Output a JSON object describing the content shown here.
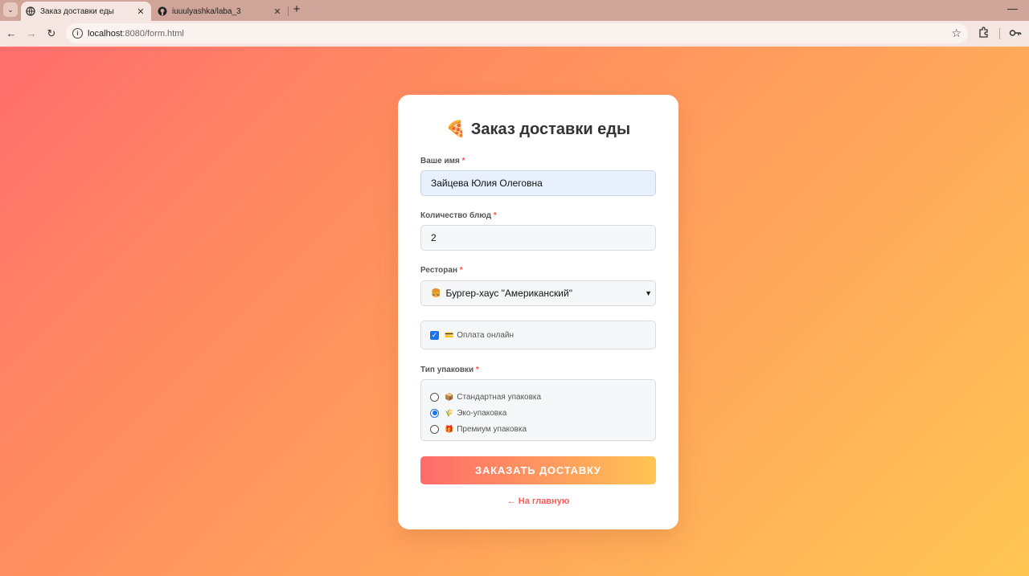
{
  "browser": {
    "tabs": [
      {
        "title": "Заказ доставки еды",
        "active": true
      },
      {
        "title": "iuuulyashka/laba_3",
        "active": false
      }
    ],
    "url_host": "localhost",
    "url_path": ":8080/form.html"
  },
  "form": {
    "title": "Заказ доставки еды",
    "title_emoji": "🍕",
    "required_marker": "*",
    "name": {
      "label": "Ваше имя",
      "value": "Зайцева Юлия Олеговна"
    },
    "quantity": {
      "label": "Количество блюд",
      "value": "2"
    },
    "restaurant": {
      "label": "Ресторан",
      "emoji": "🍔",
      "value": "Бургер-хаус \"Американский\""
    },
    "online_payment": {
      "emoji": "💳",
      "label": "Оплата онлайн",
      "checked": true
    },
    "packaging": {
      "label": "Тип упаковки",
      "options": [
        {
          "emoji": "📦",
          "label": "Стандартная упаковка",
          "selected": false
        },
        {
          "emoji": "🌾",
          "label": "Эко-упаковка",
          "selected": true
        },
        {
          "emoji": "🎁",
          "label": "Премиум упаковка",
          "selected": false
        }
      ]
    },
    "submit_label": "ЗАКАЗАТЬ ДОСТАВКУ",
    "home_link": "← На главную"
  },
  "colors": {
    "accent_start": "#ff6b6b",
    "accent_end": "#ffc553",
    "link": "#ff5a5a",
    "checkbox": "#1a73e8"
  }
}
